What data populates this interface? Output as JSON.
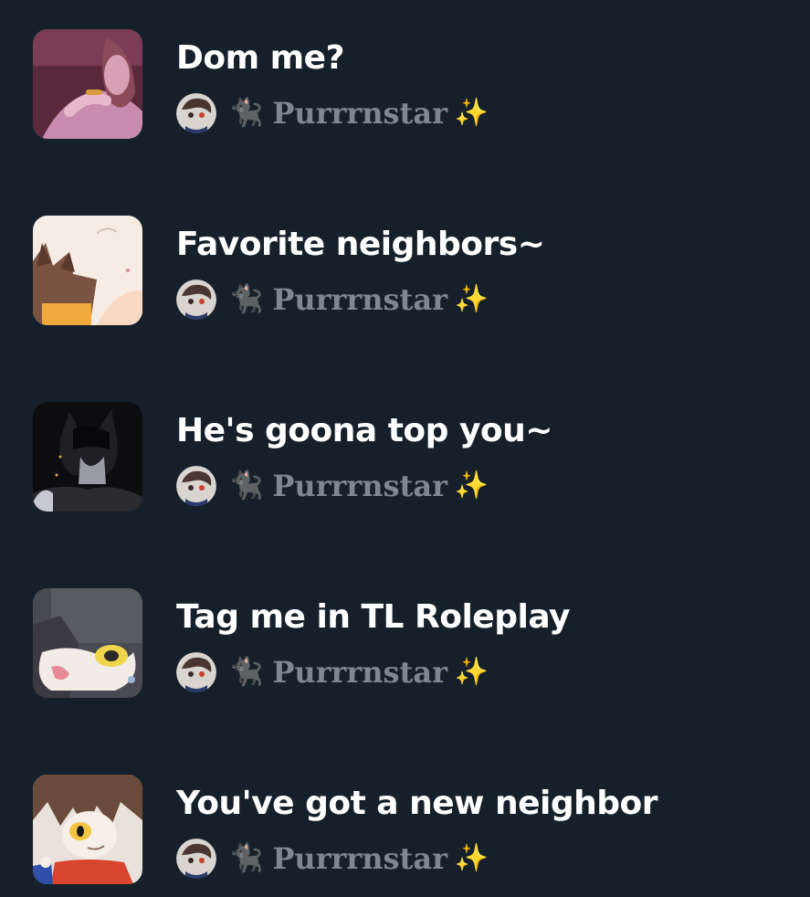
{
  "lists": [
    {
      "title": "Dom me?",
      "thumbnail_icon": "pink-figure-thumbnail",
      "author": {
        "cat": "🐈‍⬛",
        "name": "Purrrnstar",
        "sparkle": "✨"
      }
    },
    {
      "title": "Favorite neighbors~",
      "thumbnail_icon": "fox-character-thumbnail",
      "author": {
        "cat": "🐈‍⬛",
        "name": "Purrrnstar",
        "sparkle": "✨"
      }
    },
    {
      "title": "He's goona top you~",
      "thumbnail_icon": "dark-character-thumbnail",
      "author": {
        "cat": "🐈‍⬛",
        "name": "Purrrnstar",
        "sparkle": "✨"
      }
    },
    {
      "title": "Tag me in TL Roleplay",
      "thumbnail_icon": "tongue-character-thumbnail",
      "author": {
        "cat": "🐈‍⬛",
        "name": "Purrrnstar",
        "sparkle": "✨"
      }
    },
    {
      "title": "You've got a new neighbor",
      "thumbnail_icon": "yellow-eye-character-thumbnail",
      "author": {
        "cat": "🐈‍⬛",
        "name": "Purrrnstar",
        "sparkle": "✨"
      }
    }
  ],
  "colors": {
    "background": "#16202b",
    "title": "#ffffff",
    "author_name": "#7d8893"
  }
}
